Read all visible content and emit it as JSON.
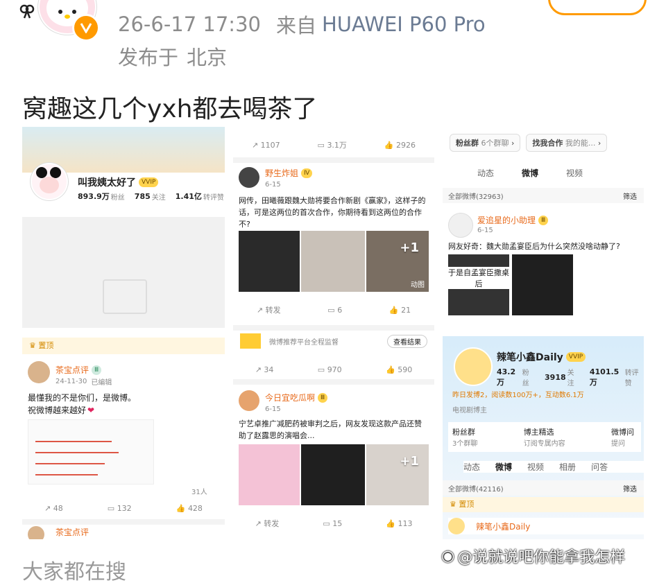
{
  "header": {
    "datetime": "26-6-17 17:30",
    "source_prefix": "来自",
    "device": "HUAWEI P60 Pro",
    "published_at_prefix": "发布于",
    "location": "北京",
    "accent": "#6b7b93"
  },
  "post": {
    "headline": "窝趣这几个yxh都去喝茶了",
    "footer_partial": "大家都在搜"
  },
  "watermark": "@说就说吧你能拿我怎样",
  "panel_a": {
    "profile": {
      "name": "叫我姨太好了",
      "followers": "893.9万",
      "followers_label": "粉丝",
      "following": "785",
      "following_label": "关注",
      "likes": "1.41亿",
      "likes_label": "转评赞",
      "vip_badge": "VVIP"
    },
    "card": {
      "pinned": "置顶",
      "user": "茶宝点评",
      "date": "24-11-30",
      "edited": "已编辑",
      "text": "最懂我的不是你们，是微博。",
      "text2": "祝微博越来越好",
      "heart": "❤",
      "comment_count": "31人",
      "actions": {
        "repost": "48",
        "comment": "132",
        "like": "428"
      },
      "next_user": "茶宝点评"
    }
  },
  "panel_b": {
    "top_actions": {
      "repost": "1107",
      "comment": "3.1万",
      "like": "2926"
    },
    "post1": {
      "user": "野生炸姐",
      "date": "6-15",
      "text": "网传，田曦薇跟魏大勋将要合作新剧《赢家》，这样子的话，可是这两位的首次合作，你期待看到这两位的合作不?",
      "more": "+1",
      "gif": "动图",
      "actions": {
        "repost": "转发",
        "comment": "6",
        "like": "21"
      }
    },
    "ad": {
      "text": "微博推荐平台全程监督",
      "btn": "查看结果"
    },
    "mid_actions": {
      "repost": "34",
      "comment": "970",
      "like": "590"
    },
    "post2": {
      "user": "今日宜吃瓜啊",
      "date": "6-15",
      "text": "宁艺卓推广减肥药被审判之后，网友发现这款产品还赞助了赵露思的演唱会...",
      "more": "+1",
      "actions": {
        "repost": "转发",
        "comment": "15",
        "like": "113"
      }
    }
  },
  "panel_c": {
    "chips": [
      {
        "label": "粉丝群",
        "sub": "6个群聊"
      },
      {
        "label": "找我合作",
        "sub": "我的能..."
      }
    ],
    "tabs": [
      "动态",
      "微博",
      "视频"
    ],
    "all_weibo": "全部微博(32963)",
    "filter": "筛选",
    "post": {
      "user": "爱追星的小助理",
      "date": "6-15",
      "text": "网友好奇：魏大勋孟宴臣后为什么突然没啥动静了?",
      "img_text": "于是自孟宴臣撒桌后"
    },
    "profile2": {
      "name": "辣笔小鑫Daily",
      "vip_badge": "VVIP",
      "followers": "43.2万",
      "followers_label": "粉丝",
      "following": "3918",
      "following_label": "关注",
      "likes": "4101.5万",
      "likes_label": "转评赞",
      "notice": "昨日发博2，阅读数100万+，互动数6.1万",
      "role": "电视剧博主",
      "grid": [
        {
          "label": "粉丝群",
          "sub": "3个群聊"
        },
        {
          "label": "博主精选",
          "sub": "订阅专属内容"
        },
        {
          "label": "微博问",
          "sub": "提问"
        }
      ],
      "tabs": [
        "动态",
        "微博",
        "视频",
        "相册",
        "问答"
      ],
      "all_weibo": "全部微博(42116)",
      "filter": "筛选",
      "pinned": "置顶",
      "next_user": "辣笔小鑫Daily"
    }
  },
  "colors": {
    "weibo_orange": "#ff8200",
    "vip_gold": "#f5b700",
    "link_blue": "#4a6fa5"
  }
}
